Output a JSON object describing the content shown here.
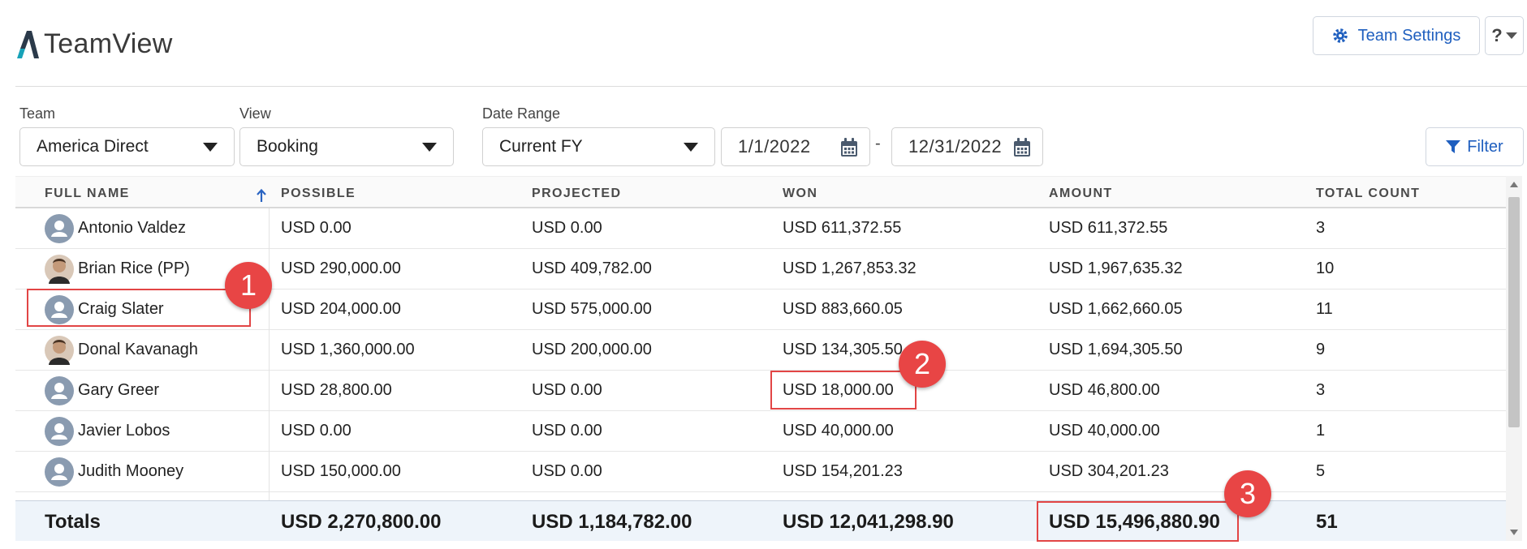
{
  "app": {
    "title": "TeamView"
  },
  "header": {
    "settings_label": "Team Settings",
    "help_label": "?"
  },
  "filters": {
    "team_label": "Team",
    "team_value": "America Direct",
    "view_label": "View",
    "view_value": "Booking",
    "daterange_label": "Date Range",
    "daterange_value": "Current FY",
    "start_date": "1/1/2022",
    "separator": "-",
    "end_date": "12/31/2022",
    "filter_label": "Filter"
  },
  "table": {
    "columns": [
      "FULL NAME",
      "POSSIBLE",
      "PROJECTED",
      "WON",
      "AMOUNT",
      "TOTAL COUNT"
    ],
    "rows": [
      {
        "name": "Antonio Valdez",
        "possible": "USD 0.00",
        "projected": "USD 0.00",
        "won": "USD 611,372.55",
        "amount": "USD 611,372.55",
        "count": "3",
        "avatar": "default-avatar-icon"
      },
      {
        "name": "Brian Rice (PP)",
        "possible": "USD 290,000.00",
        "projected": "USD 409,782.00",
        "won": "USD 1,267,853.32",
        "amount": "USD 1,967,635.32",
        "count": "10",
        "avatar": "photo-avatar"
      },
      {
        "name": "Craig Slater",
        "possible": "USD 204,000.00",
        "projected": "USD 575,000.00",
        "won": "USD 883,660.05",
        "amount": "USD 1,662,660.05",
        "count": "11",
        "avatar": "default-avatar-icon"
      },
      {
        "name": "Donal Kavanagh",
        "possible": "USD 1,360,000.00",
        "projected": "USD 200,000.00",
        "won": "USD 134,305.50",
        "amount": "USD 1,694,305.50",
        "count": "9",
        "avatar": "photo-avatar"
      },
      {
        "name": "Gary Greer",
        "possible": "USD 28,800.00",
        "projected": "USD 0.00",
        "won": "USD 18,000.00",
        "amount": "USD 46,800.00",
        "count": "3",
        "avatar": "default-avatar-icon"
      },
      {
        "name": "Javier Lobos",
        "possible": "USD 0.00",
        "projected": "USD 0.00",
        "won": "USD 40,000.00",
        "amount": "USD 40,000.00",
        "count": "1",
        "avatar": "default-avatar-icon"
      },
      {
        "name": "Judith Mooney",
        "possible": "USD 150,000.00",
        "projected": "USD 0.00",
        "won": "USD 154,201.23",
        "amount": "USD 304,201.23",
        "count": "5",
        "avatar": "default-avatar-icon"
      }
    ],
    "totals": {
      "label": "Totals",
      "possible": "USD 2,270,800.00",
      "projected": "USD 1,184,782.00",
      "won": "USD 12,041,298.90",
      "amount": "USD 15,496,880.90",
      "count": "51"
    }
  },
  "annotations": [
    "1",
    "2",
    "3"
  ],
  "colors": {
    "accent": "#1f5fbf",
    "highlight": "#e24545",
    "totals_bg": "#eef4fa",
    "logo_teal": "#17a2b8",
    "logo_dark": "#2b3a4a"
  }
}
